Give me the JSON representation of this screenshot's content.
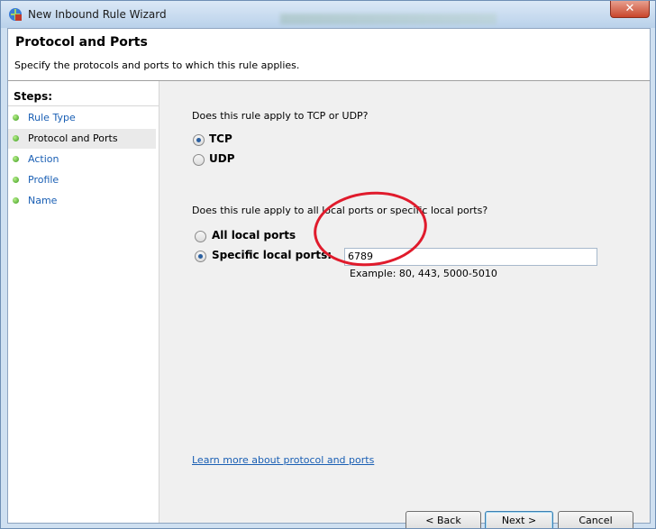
{
  "window": {
    "title": "New Inbound Rule Wizard",
    "close_label": "✕"
  },
  "header": {
    "title": "Protocol and Ports",
    "subtitle": "Specify the protocols and ports to which this rule applies."
  },
  "steps": {
    "title": "Steps:",
    "items": [
      {
        "label": "Rule Type"
      },
      {
        "label": "Protocol and Ports"
      },
      {
        "label": "Action"
      },
      {
        "label": "Profile"
      },
      {
        "label": "Name"
      }
    ]
  },
  "protocol": {
    "question": "Does this rule apply to TCP or UDP?",
    "tcp_label": "TCP",
    "udp_label": "UDP",
    "selected": "TCP"
  },
  "ports": {
    "question": "Does this rule apply to all local ports or specific local ports?",
    "all_label": "All local ports",
    "specific_label": "Specific local ports:",
    "value": "6789",
    "example": "Example: 80, 443, 5000-5010",
    "selected": "specific"
  },
  "learn_more": "Learn more about protocol and ports",
  "buttons": {
    "back": "< Back",
    "next": "Next >",
    "cancel": "Cancel"
  },
  "annotation_color": "#e01b2c"
}
